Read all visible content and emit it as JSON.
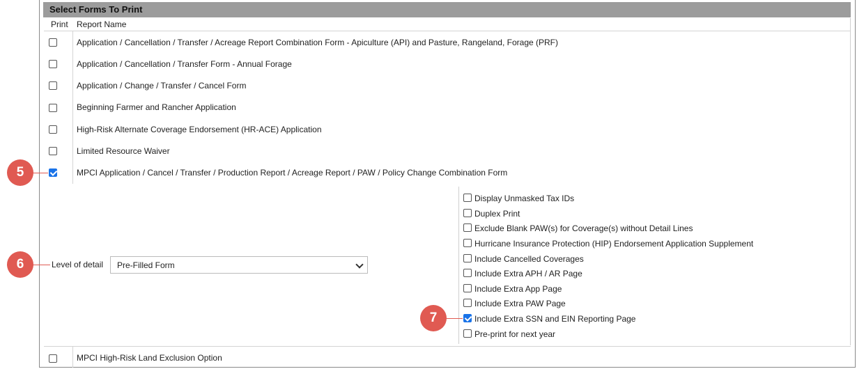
{
  "section": {
    "title": "Select Forms To Print"
  },
  "columns": {
    "print": "Print",
    "report_name": "Report Name"
  },
  "forms": [
    {
      "label": "Application / Cancellation / Transfer / Acreage Report Combination Form - Apiculture (API) and Pasture, Rangeland, Forage (PRF)",
      "checked": false
    },
    {
      "label": "Application / Cancellation / Transfer Form - Annual Forage",
      "checked": false
    },
    {
      "label": "Application / Change / Transfer / Cancel Form",
      "checked": false
    },
    {
      "label": "Beginning Farmer and Rancher Application",
      "checked": false
    },
    {
      "label": "High-Risk Alternate Coverage Endorsement (HR-ACE) Application",
      "checked": false
    },
    {
      "label": "Limited Resource Waiver",
      "checked": false
    },
    {
      "label": "MPCI Application / Cancel / Transfer / Production Report / Acreage Report / PAW / Policy Change Combination Form",
      "checked": true
    },
    {
      "label": "MPCI High-Risk Land Exclusion Option",
      "checked": false
    }
  ],
  "level_of_detail": {
    "label": "Level of detail",
    "value": "Pre-Filled Form"
  },
  "options": [
    {
      "label": "Display Unmasked Tax IDs",
      "checked": false
    },
    {
      "label": "Duplex Print",
      "checked": false
    },
    {
      "label": "Exclude Blank PAW(s) for Coverage(s) without Detail Lines",
      "checked": false
    },
    {
      "label": "Hurricane Insurance Protection (HIP) Endorsement Application Supplement",
      "checked": false
    },
    {
      "label": "Include Cancelled Coverages",
      "checked": false
    },
    {
      "label": "Include Extra APH / AR Page",
      "checked": false
    },
    {
      "label": "Include Extra App Page",
      "checked": false
    },
    {
      "label": "Include Extra PAW Page",
      "checked": false
    },
    {
      "label": "Include Extra SSN and EIN Reporting Page",
      "checked": true
    },
    {
      "label": "Pre-print for next year",
      "checked": false
    }
  ],
  "callouts": [
    "5",
    "6",
    "7"
  ],
  "colors": {
    "header_bg": "#9c9c9c",
    "check_accent": "#1a73e8",
    "callout": "#e05a52"
  }
}
